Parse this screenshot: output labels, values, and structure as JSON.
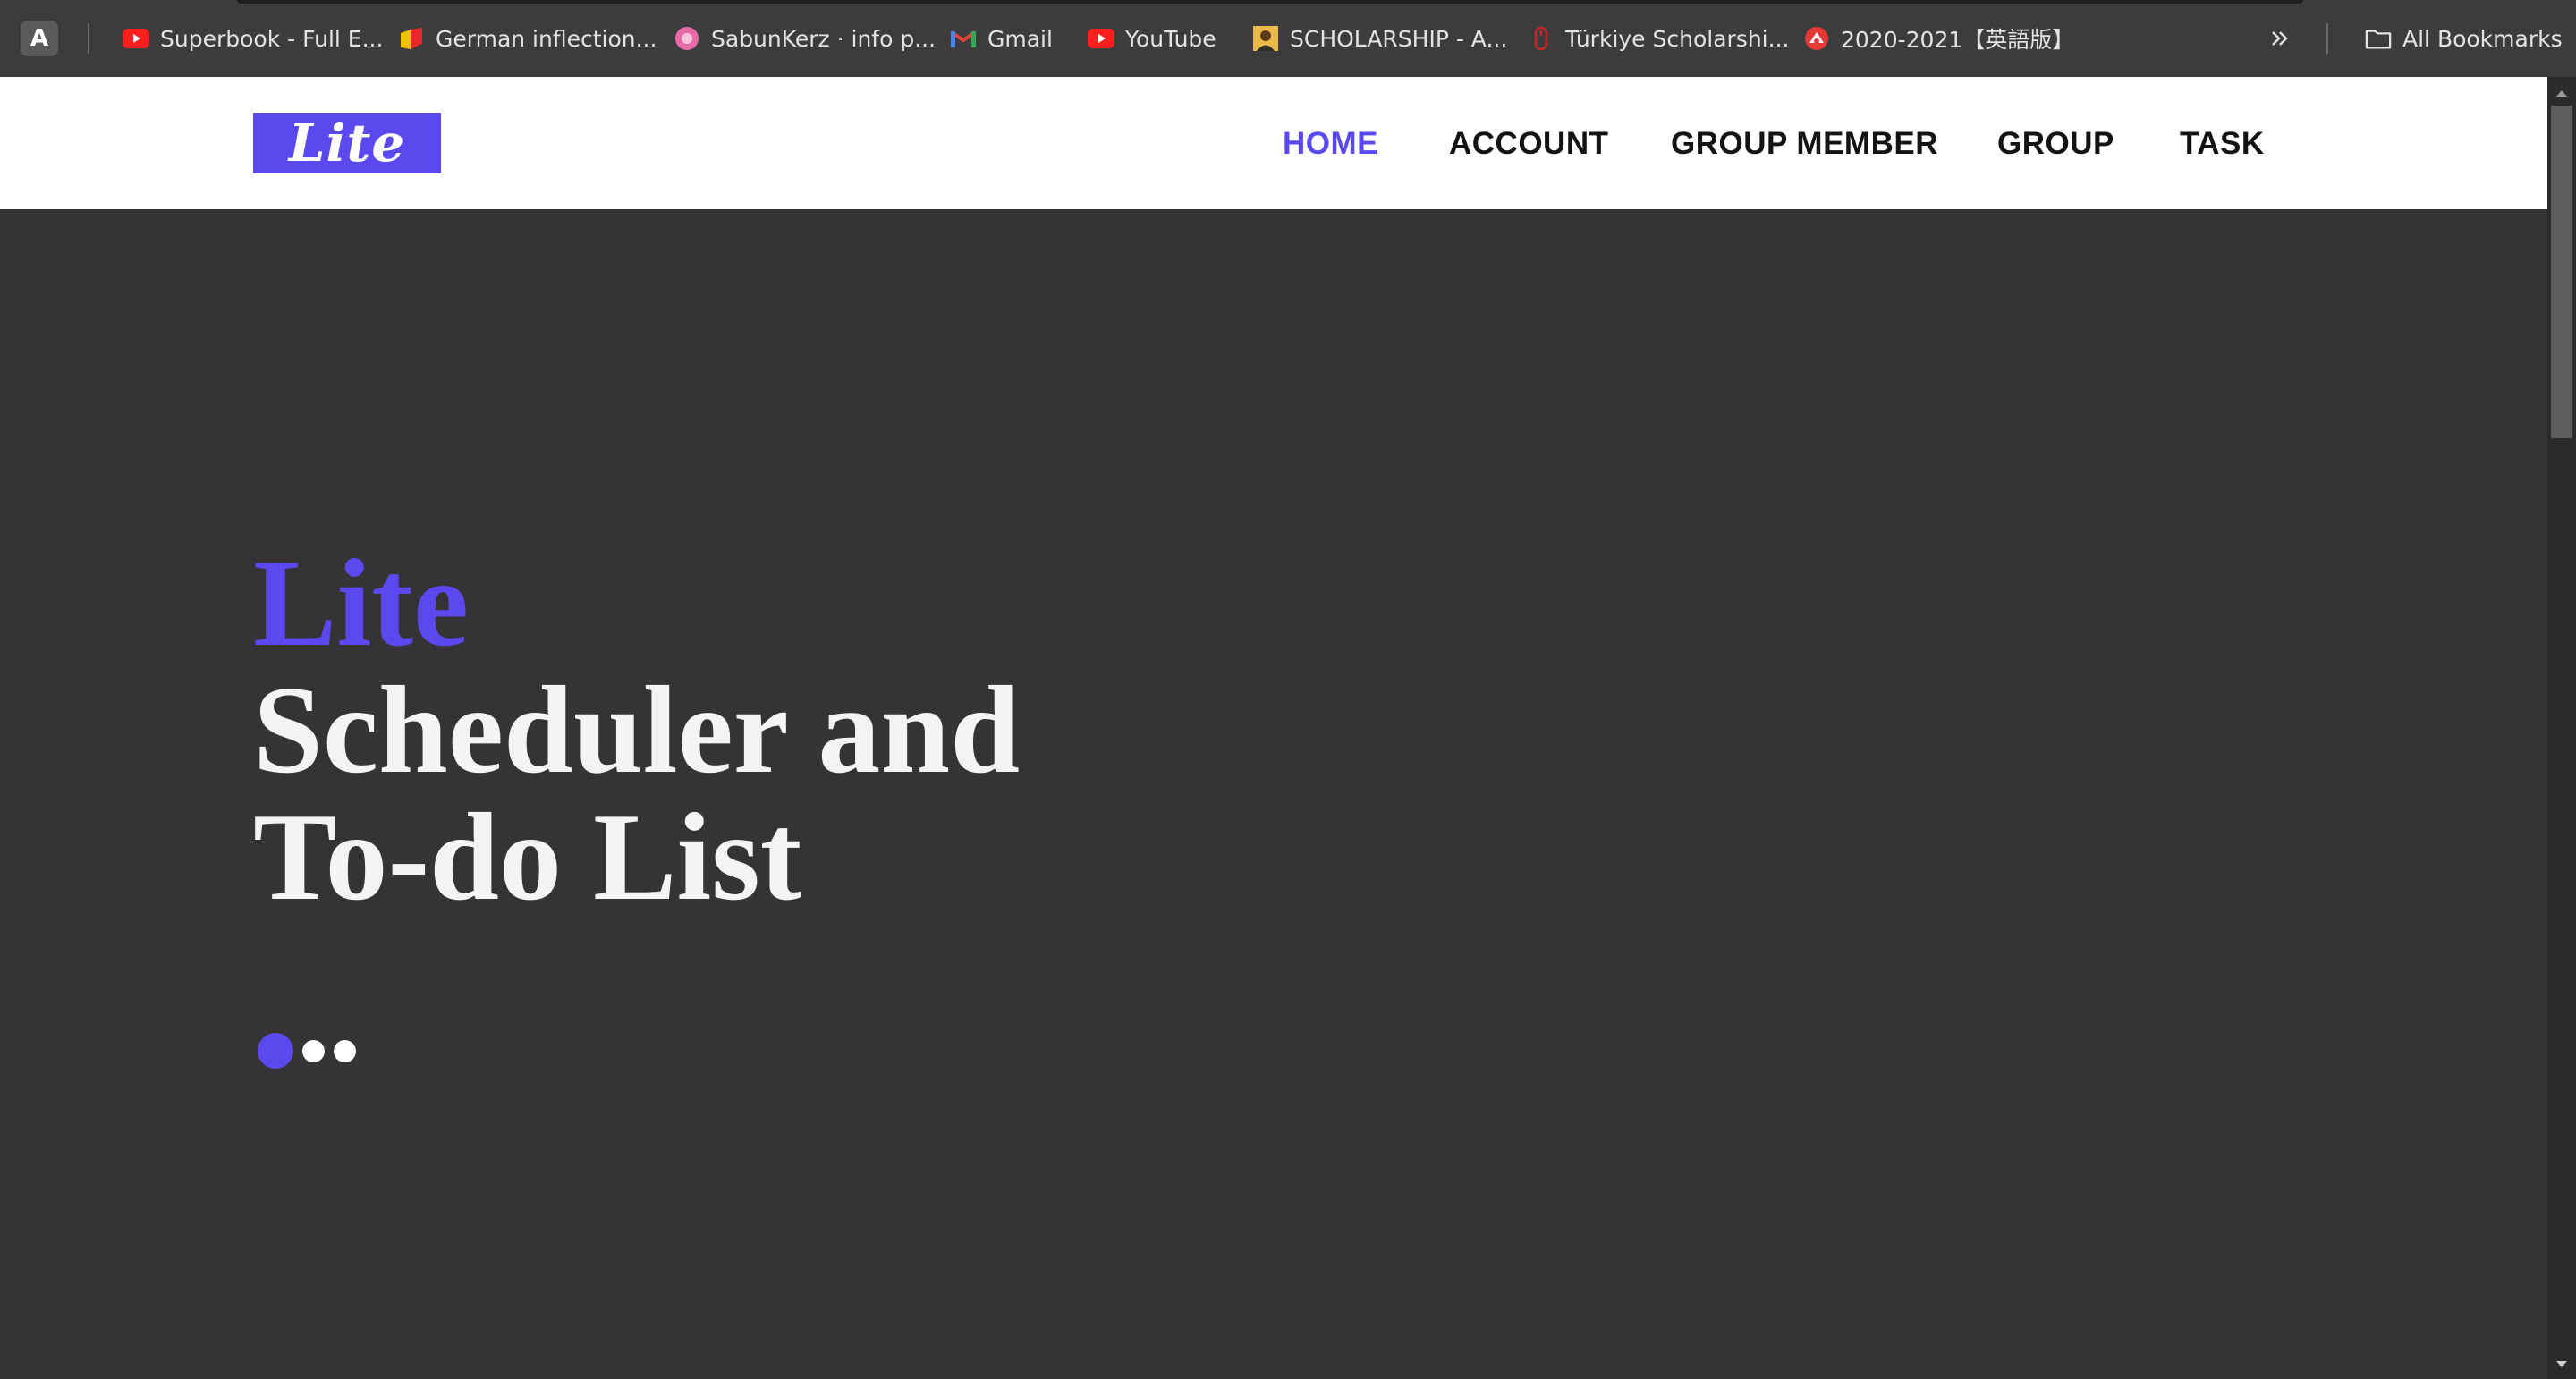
{
  "bookmarks_bar": {
    "profile_initial": "A",
    "items": [
      {
        "label": "Superbook - Full E...",
        "icon": "youtube-icon"
      },
      {
        "label": "German inflection...",
        "icon": "flag-icon"
      },
      {
        "label": "SabunKerz · info p...",
        "icon": "pink-circle-icon"
      },
      {
        "label": "Gmail",
        "icon": "gmail-icon"
      },
      {
        "label": "YouTube",
        "icon": "youtube-icon"
      },
      {
        "label": "SCHOLARSHIP - A...",
        "icon": "portrait-icon"
      },
      {
        "label": "Türkiye Scholarshi...",
        "icon": "mouse-icon"
      },
      {
        "label": "2020-2021【英語版】",
        "icon": "red-logo-icon"
      }
    ],
    "more_icon": "chevron-double-right-icon",
    "all_bookmarks_label": "All Bookmarks"
  },
  "navbar": {
    "logo_text": "Lite",
    "items": [
      {
        "label": "HOME",
        "active": true
      },
      {
        "label": "ACCOUNT",
        "active": false
      },
      {
        "label": "GROUP MEMBER",
        "active": false
      },
      {
        "label": "GROUP",
        "active": false
      },
      {
        "label": "TASK",
        "active": false
      }
    ]
  },
  "hero": {
    "title_accent": "Lite",
    "title_line1": "Scheduler and",
    "title_line2": "To-do List",
    "slides_count": 3,
    "active_slide": 1
  },
  "colors": {
    "accent": "#5b49ef",
    "hero_bg": "#353336",
    "navbar_bg": "#ffffff",
    "bookmarks_bg": "#3c3c3c"
  }
}
